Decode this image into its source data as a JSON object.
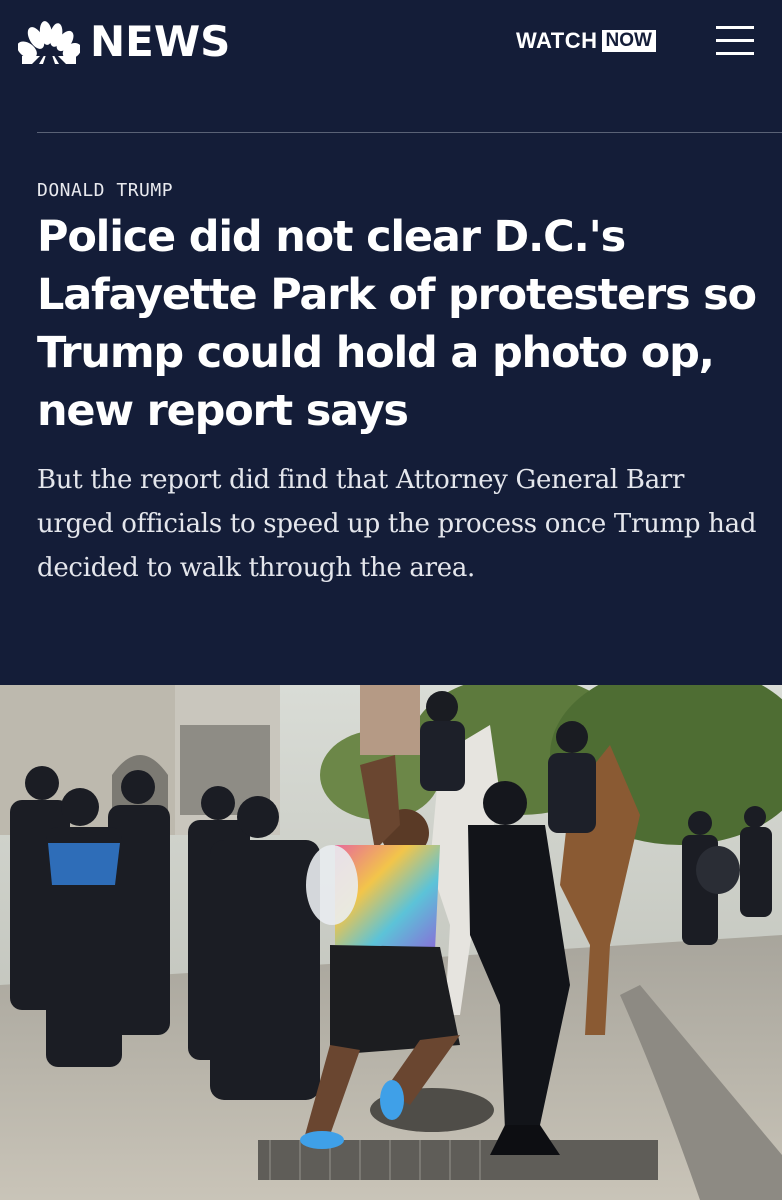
{
  "header": {
    "logo_text": "NEWS",
    "logo_icon": "peacock-icon",
    "watch_label": "WATCH",
    "now_label": "NOW",
    "menu_icon": "hamburger-menu-icon"
  },
  "article": {
    "category": "DONALD TRUMP",
    "headline": "Police did not clear D.C.'s Lafayette Park of protesters so Trump could hold a photo op, new report says",
    "dek": "But the report did find that Attorney General Barr urged officials to speed up the process once Trump had decided to walk through the area."
  },
  "colors": {
    "header_bg": "#141d38",
    "text": "#ffffff"
  }
}
